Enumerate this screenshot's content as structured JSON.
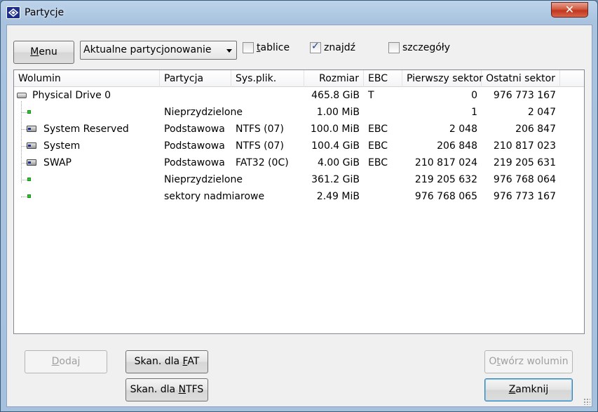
{
  "window": {
    "title": "Partycje",
    "close_glyph": "✕"
  },
  "toolbar": {
    "menu_label_prefix": "",
    "menu_label_hotkey": "M",
    "menu_label_rest": "enu",
    "combo_value": "Aktualne partycjonowanie",
    "check_tablice": {
      "label_hotkey": "t",
      "label_rest": "ablice",
      "checked": false
    },
    "check_znajdz": {
      "label_pre": "zna",
      "label_hotkey": "j",
      "label_rest": "dź",
      "checked": true
    },
    "check_szczegoly": {
      "label_pre": "szcze",
      "label_hotkey": "g",
      "label_rest": "óły",
      "checked": false
    }
  },
  "table": {
    "columns": [
      "Wolumin",
      "Partycja",
      "Sys.plik.",
      "Rozmiar",
      "EBC",
      "Pierwszy sektor",
      "Ostatni sektor"
    ],
    "rows": [
      {
        "kind": "drive",
        "volume": "Physical Drive 0",
        "partition": "",
        "fs": "",
        "size": "465.8 GiB",
        "ebc": "T",
        "first": "0",
        "last": "976 773 167"
      },
      {
        "kind": "free",
        "volume": "",
        "partition": "Nieprzydzielone",
        "fs": "",
        "size": "1.00 MiB",
        "ebc": "",
        "first": "1",
        "last": "2 047"
      },
      {
        "kind": "part",
        "volume": "System Reserved",
        "partition": "Podstawowa",
        "fs": "NTFS (07)",
        "size": "100.0 MiB",
        "ebc": "EBC",
        "first": "2 048",
        "last": "206 847"
      },
      {
        "kind": "part",
        "volume": "System",
        "partition": "Podstawowa",
        "fs": "NTFS (07)",
        "size": "100.4 GiB",
        "ebc": "EBC",
        "first": "206 848",
        "last": "210 817 023"
      },
      {
        "kind": "part",
        "volume": "SWAP",
        "partition": "Podstawowa",
        "fs": "FAT32 (0C)",
        "size": "4.00 GiB",
        "ebc": "EBC",
        "first": "210 817 024",
        "last": "219 205 631"
      },
      {
        "kind": "free",
        "volume": "",
        "partition": "Nieprzydzielone",
        "fs": "",
        "size": "361.2 GiB",
        "ebc": "",
        "first": "219 205 632",
        "last": "976 768 064"
      },
      {
        "kind": "free",
        "volume": "",
        "partition": "sektory nadmiarowe",
        "fs": "",
        "size": "2.49 MiB",
        "ebc": "",
        "first": "976 768 065",
        "last": "976 773 167"
      }
    ]
  },
  "buttons": {
    "dodaj": {
      "hotkey": "D",
      "rest": "odaj"
    },
    "skan_fat": {
      "pre": "Skan. dla ",
      "hotkey": "F",
      "rest": "AT"
    },
    "skan_ntfs": {
      "pre": "Skan. dla ",
      "hotkey": "N",
      "rest": "TFS"
    },
    "otworz": {
      "pre": "O",
      "hotkey": "t",
      "rest": "wórz wolumin"
    },
    "zamknij": {
      "hotkey": "Z",
      "rest": "amknij"
    }
  },
  "colors": {
    "accent": "#1c2f8a",
    "free": "#27c827",
    "close": "#c0361d"
  }
}
